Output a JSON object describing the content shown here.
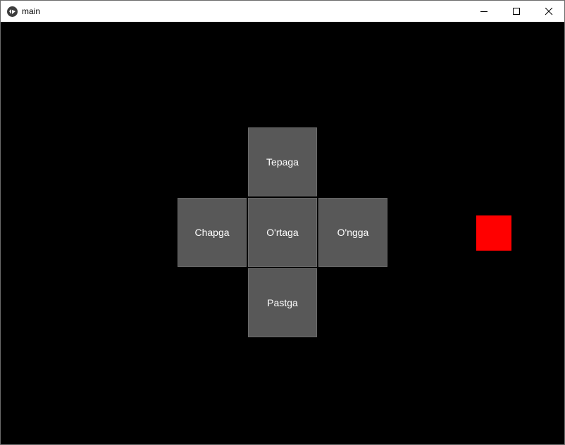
{
  "window": {
    "title": "main",
    "icon": "kivy-app-icon",
    "controls": [
      "minimize-icon",
      "maximize-icon",
      "close-icon"
    ]
  },
  "dpad": {
    "up_label": "Tepaga",
    "left_label": "Chapga",
    "center_label": "O'rtaga",
    "right_label": "O'ngga",
    "down_label": "Pastga",
    "button_color": "#585858"
  },
  "marker": {
    "color": "#ff0000"
  },
  "colors": {
    "background": "#000000"
  }
}
